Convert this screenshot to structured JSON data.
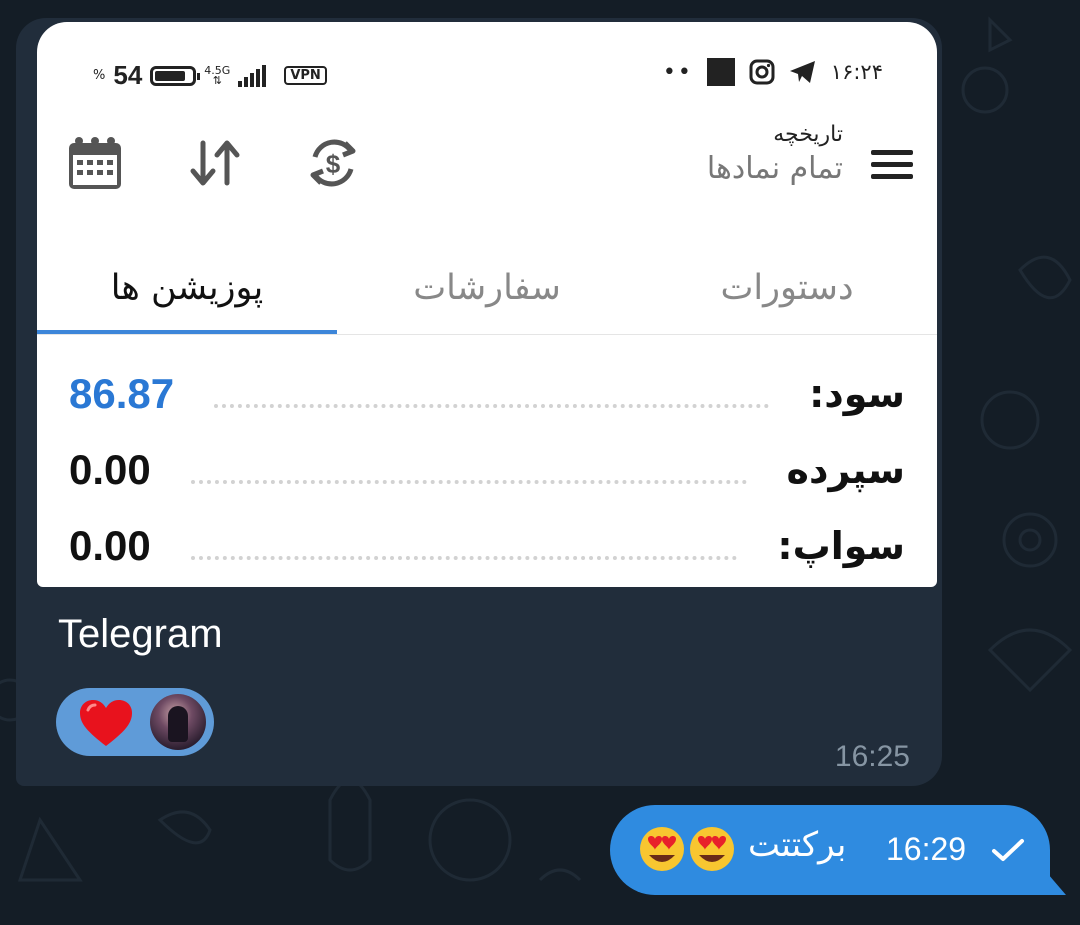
{
  "screenshot": {
    "status_bar": {
      "percent_sign": "%",
      "battery_level": "54",
      "network": "4.5G",
      "vpn": "VPN",
      "dots": "••",
      "time": "۱۶:۲۴",
      "icons": [
        "battery-icon",
        "signal-icon",
        "square-icon",
        "instagram-icon",
        "telegram-icon"
      ]
    },
    "header": {
      "title": "تاریخچه",
      "subtitle": "تمام نمادها",
      "icons": [
        "menu-icon",
        "currency-exchange-icon",
        "sort-arrows-icon",
        "calendar-icon"
      ]
    },
    "tabs": [
      {
        "label": "پوزیشن ها",
        "active": true
      },
      {
        "label": "سفارشات",
        "active": false
      },
      {
        "label": "دستورات",
        "active": false
      }
    ],
    "summary": [
      {
        "label": "سود:",
        "value": "86.87",
        "highlight": true
      },
      {
        "label": "سپرده",
        "value": "0.00",
        "highlight": false
      },
      {
        "label": "سواپ:",
        "value": "0.00",
        "highlight": false
      }
    ]
  },
  "message_in": {
    "caption": "Telegram",
    "reaction_emoji": "heart-icon",
    "time": "16:25"
  },
  "message_out": {
    "text": "برکتتت",
    "emoji": "heart-eyes-emoji",
    "time": "16:29",
    "status_icon": "check-icon"
  },
  "colors": {
    "background": "#141d26",
    "bubble_in": "#212d3b",
    "bubble_out": "#2f8be0",
    "accent_blue": "#2a78d4"
  }
}
